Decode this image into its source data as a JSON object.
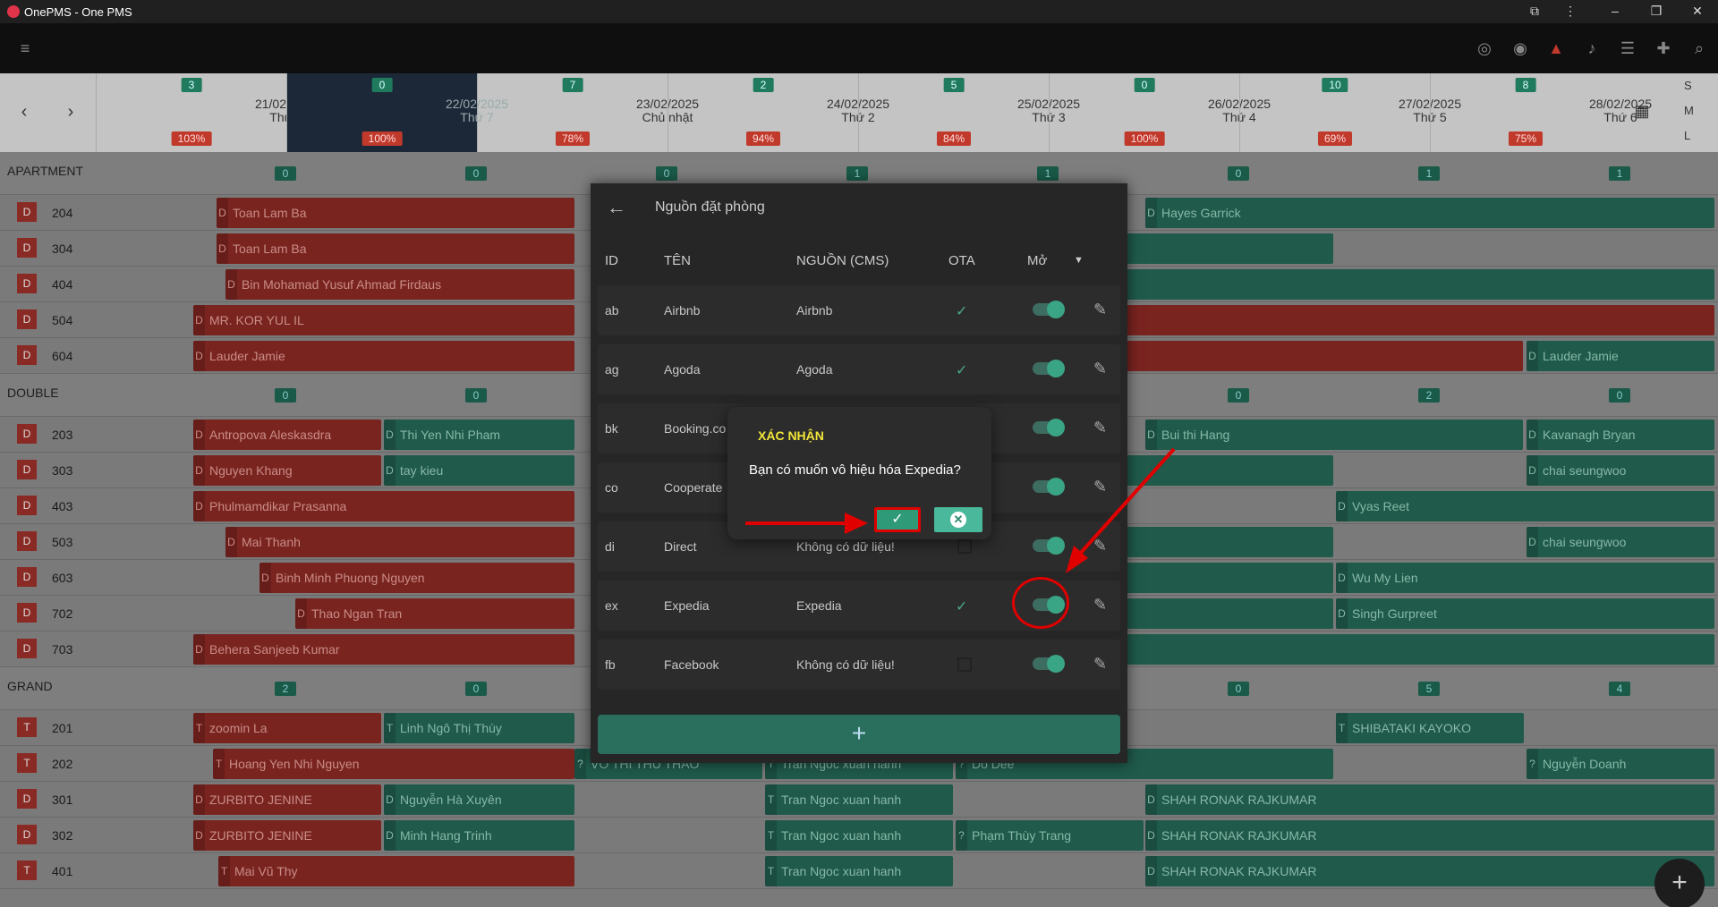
{
  "window": {
    "title": "OnePMS - One PMS"
  },
  "nav": {
    "prev": "‹",
    "next": "›"
  },
  "dates": [
    {
      "count": "3",
      "date": "21/02/2025",
      "weekday": "Thứ 6",
      "occupancy": "103%"
    },
    {
      "count": "0",
      "date": "22/02/2025",
      "weekday": "Thứ 7",
      "occupancy": "100%"
    },
    {
      "count": "7",
      "date": "23/02/2025",
      "weekday": "Chủ nhật",
      "occupancy": "78%"
    },
    {
      "count": "2",
      "date": "24/02/2025",
      "weekday": "Thứ 2",
      "occupancy": "94%"
    },
    {
      "count": "5",
      "date": "25/02/2025",
      "weekday": "Thứ 3",
      "occupancy": "84%"
    },
    {
      "count": "0",
      "date": "26/02/2025",
      "weekday": "Thứ 4",
      "occupancy": "100%"
    },
    {
      "count": "10",
      "date": "27/02/2025",
      "weekday": "Thứ 5",
      "occupancy": "69%"
    },
    {
      "count": "8",
      "date": "28/02/2025",
      "weekday": "Thứ 6",
      "occupancy": "75%"
    }
  ],
  "size_switch": [
    "S",
    "M",
    "L"
  ],
  "groups": [
    {
      "name": "APARTMENT",
      "counts": [
        "0",
        "0",
        "0",
        "1",
        "1",
        "0",
        "1",
        "1"
      ]
    },
    {
      "name": "DOUBLE",
      "counts": [
        "0",
        "0",
        "",
        "",
        "",
        "0",
        "2",
        "0"
      ]
    },
    {
      "name": "GRAND",
      "counts": [
        "2",
        "0",
        "",
        "",
        "",
        "0",
        "5",
        "4"
      ]
    }
  ],
  "rooms": [
    {
      "type": "D",
      "no": "204"
    },
    {
      "type": "D",
      "no": "304"
    },
    {
      "type": "D",
      "no": "404"
    },
    {
      "type": "D",
      "no": "504"
    },
    {
      "type": "D",
      "no": "604"
    },
    {
      "type": "D",
      "no": "203"
    },
    {
      "type": "D",
      "no": "303"
    },
    {
      "type": "D",
      "no": "403"
    },
    {
      "type": "D",
      "no": "503"
    },
    {
      "type": "D",
      "no": "603"
    },
    {
      "type": "D",
      "no": "702"
    },
    {
      "type": "D",
      "no": "703"
    },
    {
      "type": "T",
      "no": "201"
    },
    {
      "type": "T",
      "no": "202"
    },
    {
      "type": "D",
      "no": "301"
    },
    {
      "type": "D",
      "no": "302"
    },
    {
      "type": "T",
      "no": "401"
    }
  ],
  "bookings": {
    "b204a": "Toan Lam Ba",
    "b204b": "Hayes Garrick",
    "b304a": "Toan Lam Ba",
    "b404a": "Bin Mohamad Yusuf Ahmad Firdaus",
    "b504a": "MR. KOR YUL IL",
    "b604a": "Lauder Jamie",
    "b604b": "Lauder Jamie",
    "b203a": "Antropova Aleskasdra",
    "b203b": "Thi Yen Nhi Pham",
    "b203c": "Bui thi Hang",
    "b203d": "Kavanagh Bryan",
    "b303a": "Nguyen Khang",
    "b303b": "tay kieu",
    "b303c": "chai seungwoo",
    "b403a": "Phulmamdikar Prasanna",
    "b403b": "Vyas Reet",
    "b503a": "Mai Thanh",
    "b503b": "chai seungwoo",
    "b603a": "Binh Minh Phuong Nguyen",
    "b603b": "Wu My Lien",
    "b702a": "Thao Ngan Tran",
    "b702b": "Singh Gurpreet",
    "b703a": "Behera Sanjeeb Kumar",
    "b201a": "zoomin La",
    "b201b": "Linh Ngô Thị Thùy",
    "b201c": "SHIBATAKI KAYOKO",
    "b202a": "Hoang Yen Nhi Nguyen",
    "b202b": "VO THI THU THAO",
    "b202c": "Tran Ngoc xuan hanh",
    "b202d": "Do Dee",
    "b202e": "Nguyễn Doanh",
    "b301a": "ZURBITO JENINE",
    "b301b": "Nguyễn Hà Xuyên",
    "b301c": "Tran Ngoc xuan hanh",
    "b301d": "SHAH RONAK RAJKUMAR",
    "b302a": "ZURBITO JENINE",
    "b302b": "Minh Hang Trinh",
    "b302c": "Tran Ngoc xuan hanh",
    "b302d": "Phạm Thùy Trang",
    "b302e": "SHAH RONAK RAJKUMAR",
    "b401a": "Mai Vũ Thy",
    "b401b": "Tran Ngoc xuan hanh",
    "b401c": "SHAH RONAK RAJKUMAR"
  },
  "dialog": {
    "title": "Nguồn đặt phòng",
    "columns": {
      "id": "ID",
      "name": "TÊN",
      "source": "NGUỒN (CMS)",
      "ota": "OTA",
      "open": "Mở"
    },
    "rows": [
      {
        "id": "ab",
        "name": "Airbnb",
        "source": "Airbnb",
        "ota": true,
        "enabled": true
      },
      {
        "id": "ag",
        "name": "Agoda",
        "source": "Agoda",
        "ota": true,
        "enabled": true
      },
      {
        "id": "bk",
        "name": "Booking.co",
        "source": "",
        "ota": true,
        "enabled": true
      },
      {
        "id": "co",
        "name": "Cooperate",
        "source": "",
        "ota": true,
        "enabled": true
      },
      {
        "id": "di",
        "name": "Direct",
        "source": "Không có dữ liệu!",
        "ota": false,
        "enabled": true
      },
      {
        "id": "ex",
        "name": "Expedia",
        "source": "Expedia",
        "ota": true,
        "enabled": true
      },
      {
        "id": "fb",
        "name": "Facebook",
        "source": "Không có dữ liệu!",
        "ota": false,
        "enabled": true
      }
    ],
    "add_label": "+"
  },
  "confirm": {
    "title": "XÁC NHẬN",
    "message": "Bạn có muốn vô hiệu hóa Expedia?",
    "ok": "✓",
    "cancel": "✕"
  },
  "fab": "+",
  "colors": {
    "accent": "#2f9a78",
    "highlight": "#e00000",
    "confirm_title": "#f1e63a"
  }
}
